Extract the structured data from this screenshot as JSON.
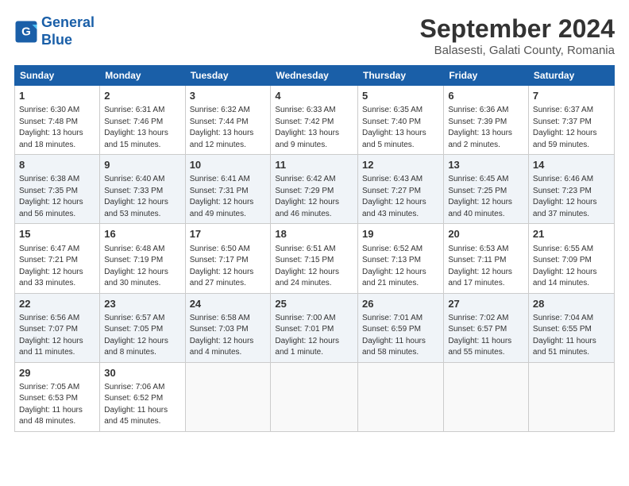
{
  "logo": {
    "line1": "General",
    "line2": "Blue"
  },
  "title": "September 2024",
  "subtitle": "Balasesti, Galati County, Romania",
  "headers": [
    "Sunday",
    "Monday",
    "Tuesday",
    "Wednesday",
    "Thursday",
    "Friday",
    "Saturday"
  ],
  "weeks": [
    [
      {
        "day": "1",
        "info": "Sunrise: 6:30 AM\nSunset: 7:48 PM\nDaylight: 13 hours and 18 minutes."
      },
      {
        "day": "2",
        "info": "Sunrise: 6:31 AM\nSunset: 7:46 PM\nDaylight: 13 hours and 15 minutes."
      },
      {
        "day": "3",
        "info": "Sunrise: 6:32 AM\nSunset: 7:44 PM\nDaylight: 13 hours and 12 minutes."
      },
      {
        "day": "4",
        "info": "Sunrise: 6:33 AM\nSunset: 7:42 PM\nDaylight: 13 hours and 9 minutes."
      },
      {
        "day": "5",
        "info": "Sunrise: 6:35 AM\nSunset: 7:40 PM\nDaylight: 13 hours and 5 minutes."
      },
      {
        "day": "6",
        "info": "Sunrise: 6:36 AM\nSunset: 7:39 PM\nDaylight: 13 hours and 2 minutes."
      },
      {
        "day": "7",
        "info": "Sunrise: 6:37 AM\nSunset: 7:37 PM\nDaylight: 12 hours and 59 minutes."
      }
    ],
    [
      {
        "day": "8",
        "info": "Sunrise: 6:38 AM\nSunset: 7:35 PM\nDaylight: 12 hours and 56 minutes."
      },
      {
        "day": "9",
        "info": "Sunrise: 6:40 AM\nSunset: 7:33 PM\nDaylight: 12 hours and 53 minutes."
      },
      {
        "day": "10",
        "info": "Sunrise: 6:41 AM\nSunset: 7:31 PM\nDaylight: 12 hours and 49 minutes."
      },
      {
        "day": "11",
        "info": "Sunrise: 6:42 AM\nSunset: 7:29 PM\nDaylight: 12 hours and 46 minutes."
      },
      {
        "day": "12",
        "info": "Sunrise: 6:43 AM\nSunset: 7:27 PM\nDaylight: 12 hours and 43 minutes."
      },
      {
        "day": "13",
        "info": "Sunrise: 6:45 AM\nSunset: 7:25 PM\nDaylight: 12 hours and 40 minutes."
      },
      {
        "day": "14",
        "info": "Sunrise: 6:46 AM\nSunset: 7:23 PM\nDaylight: 12 hours and 37 minutes."
      }
    ],
    [
      {
        "day": "15",
        "info": "Sunrise: 6:47 AM\nSunset: 7:21 PM\nDaylight: 12 hours and 33 minutes."
      },
      {
        "day": "16",
        "info": "Sunrise: 6:48 AM\nSunset: 7:19 PM\nDaylight: 12 hours and 30 minutes."
      },
      {
        "day": "17",
        "info": "Sunrise: 6:50 AM\nSunset: 7:17 PM\nDaylight: 12 hours and 27 minutes."
      },
      {
        "day": "18",
        "info": "Sunrise: 6:51 AM\nSunset: 7:15 PM\nDaylight: 12 hours and 24 minutes."
      },
      {
        "day": "19",
        "info": "Sunrise: 6:52 AM\nSunset: 7:13 PM\nDaylight: 12 hours and 21 minutes."
      },
      {
        "day": "20",
        "info": "Sunrise: 6:53 AM\nSunset: 7:11 PM\nDaylight: 12 hours and 17 minutes."
      },
      {
        "day": "21",
        "info": "Sunrise: 6:55 AM\nSunset: 7:09 PM\nDaylight: 12 hours and 14 minutes."
      }
    ],
    [
      {
        "day": "22",
        "info": "Sunrise: 6:56 AM\nSunset: 7:07 PM\nDaylight: 12 hours and 11 minutes."
      },
      {
        "day": "23",
        "info": "Sunrise: 6:57 AM\nSunset: 7:05 PM\nDaylight: 12 hours and 8 minutes."
      },
      {
        "day": "24",
        "info": "Sunrise: 6:58 AM\nSunset: 7:03 PM\nDaylight: 12 hours and 4 minutes."
      },
      {
        "day": "25",
        "info": "Sunrise: 7:00 AM\nSunset: 7:01 PM\nDaylight: 12 hours and 1 minute."
      },
      {
        "day": "26",
        "info": "Sunrise: 7:01 AM\nSunset: 6:59 PM\nDaylight: 11 hours and 58 minutes."
      },
      {
        "day": "27",
        "info": "Sunrise: 7:02 AM\nSunset: 6:57 PM\nDaylight: 11 hours and 55 minutes."
      },
      {
        "day": "28",
        "info": "Sunrise: 7:04 AM\nSunset: 6:55 PM\nDaylight: 11 hours and 51 minutes."
      }
    ],
    [
      {
        "day": "29",
        "info": "Sunrise: 7:05 AM\nSunset: 6:53 PM\nDaylight: 11 hours and 48 minutes."
      },
      {
        "day": "30",
        "info": "Sunrise: 7:06 AM\nSunset: 6:52 PM\nDaylight: 11 hours and 45 minutes."
      },
      {
        "day": "",
        "info": ""
      },
      {
        "day": "",
        "info": ""
      },
      {
        "day": "",
        "info": ""
      },
      {
        "day": "",
        "info": ""
      },
      {
        "day": "",
        "info": ""
      }
    ]
  ]
}
